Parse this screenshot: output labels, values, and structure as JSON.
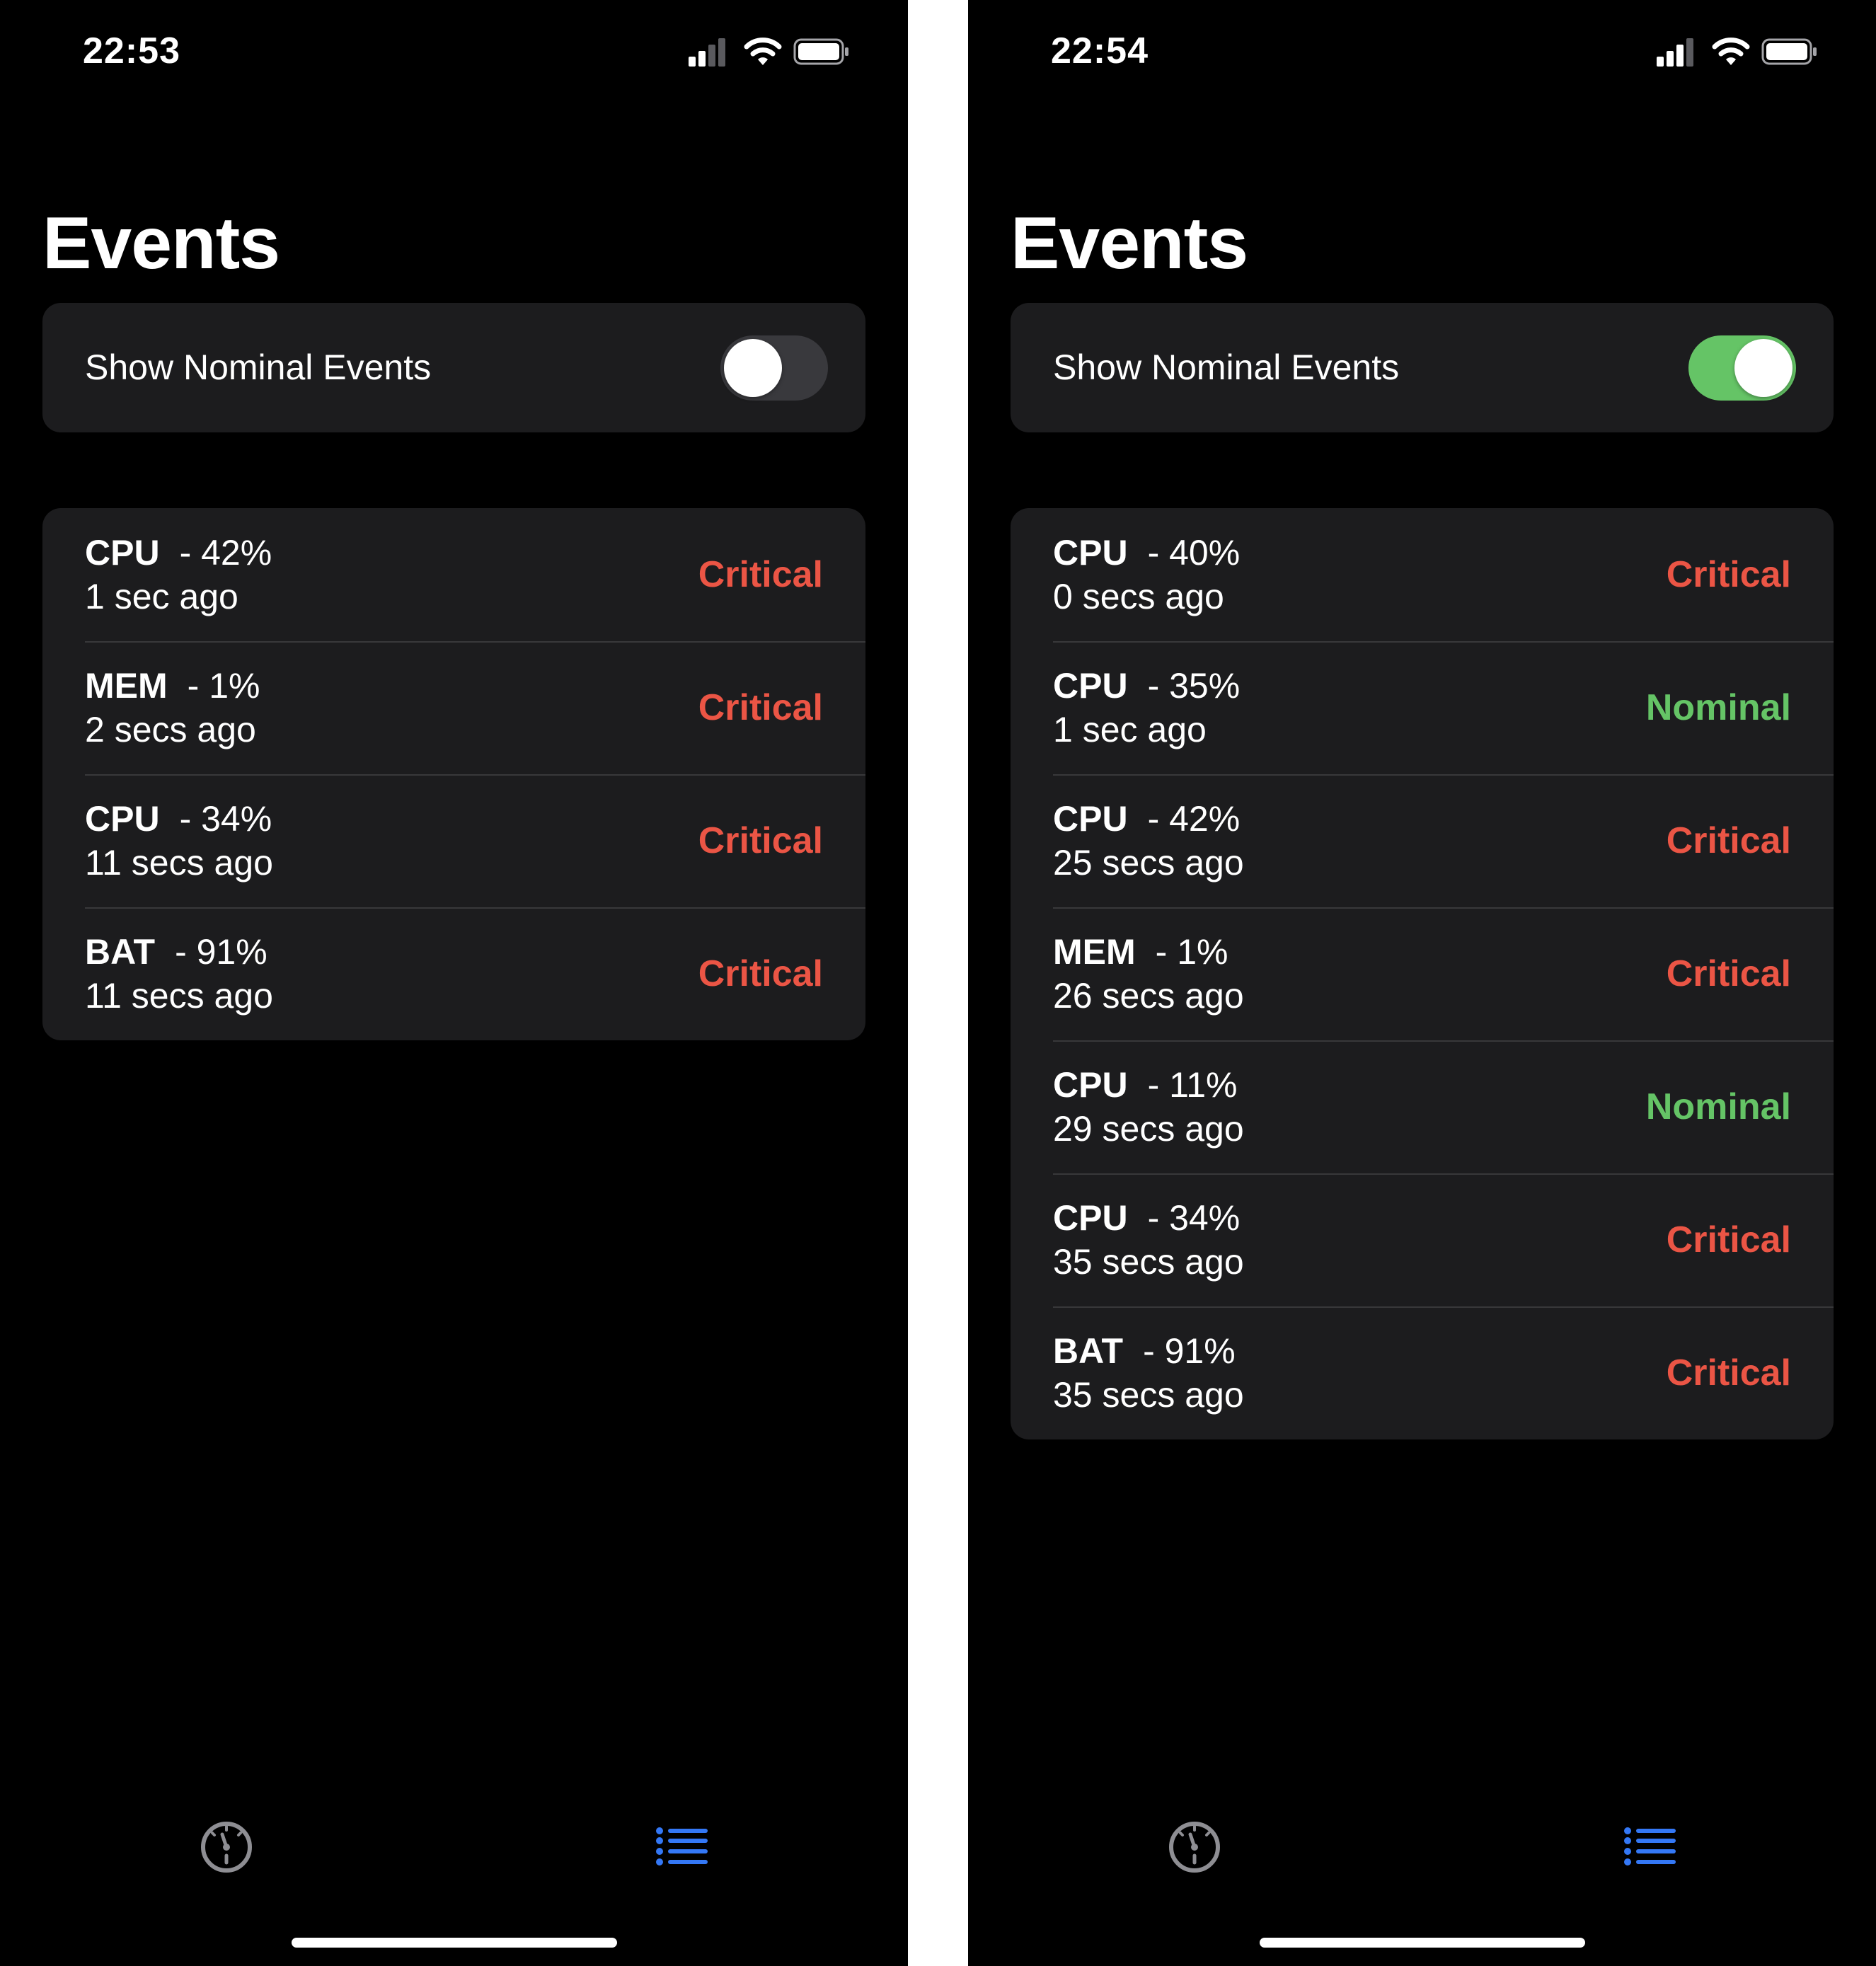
{
  "colors": {
    "background": "#000000",
    "card": "#1c1c1e",
    "critical": "#eb5545",
    "nominal": "#65c466",
    "switch_off": "#39393d",
    "tab_active": "#3478f6",
    "tab_inactive": "#8e8e93"
  },
  "screens": [
    {
      "status_bar": {
        "time": "22:53",
        "icons": [
          "cellular-signal-icon",
          "wifi-icon",
          "battery-icon"
        ]
      },
      "title": "Events",
      "toggle": {
        "label": "Show Nominal Events",
        "on": false
      },
      "events": [
        {
          "kind": "CPU",
          "value": "- 42%",
          "time": "1 sec ago",
          "status": "Critical"
        },
        {
          "kind": "MEM",
          "value": "- 1%",
          "time": "2 secs ago",
          "status": "Critical"
        },
        {
          "kind": "CPU",
          "value": "- 34%",
          "time": "11 secs ago",
          "status": "Critical"
        },
        {
          "kind": "BAT",
          "value": "- 91%",
          "time": "11 secs ago",
          "status": "Critical"
        }
      ],
      "tabs": [
        {
          "icon": "gauge-icon",
          "active": false
        },
        {
          "icon": "list-icon",
          "active": true
        }
      ]
    },
    {
      "status_bar": {
        "time": "22:54",
        "icons": [
          "cellular-signal-icon",
          "wifi-icon",
          "battery-icon"
        ]
      },
      "title": "Events",
      "toggle": {
        "label": "Show Nominal Events",
        "on": true
      },
      "events": [
        {
          "kind": "CPU",
          "value": "- 40%",
          "time": "0 secs ago",
          "status": "Critical"
        },
        {
          "kind": "CPU",
          "value": "- 35%",
          "time": "1 sec ago",
          "status": "Nominal"
        },
        {
          "kind": "CPU",
          "value": "- 42%",
          "time": "25 secs ago",
          "status": "Critical"
        },
        {
          "kind": "MEM",
          "value": "- 1%",
          "time": "26 secs ago",
          "status": "Critical"
        },
        {
          "kind": "CPU",
          "value": "- 11%",
          "time": "29 secs ago",
          "status": "Nominal"
        },
        {
          "kind": "CPU",
          "value": "- 34%",
          "time": "35 secs ago",
          "status": "Critical"
        },
        {
          "kind": "BAT",
          "value": "- 91%",
          "time": "35 secs ago",
          "status": "Critical"
        }
      ],
      "tabs": [
        {
          "icon": "gauge-icon",
          "active": false
        },
        {
          "icon": "list-icon",
          "active": true
        }
      ]
    }
  ]
}
